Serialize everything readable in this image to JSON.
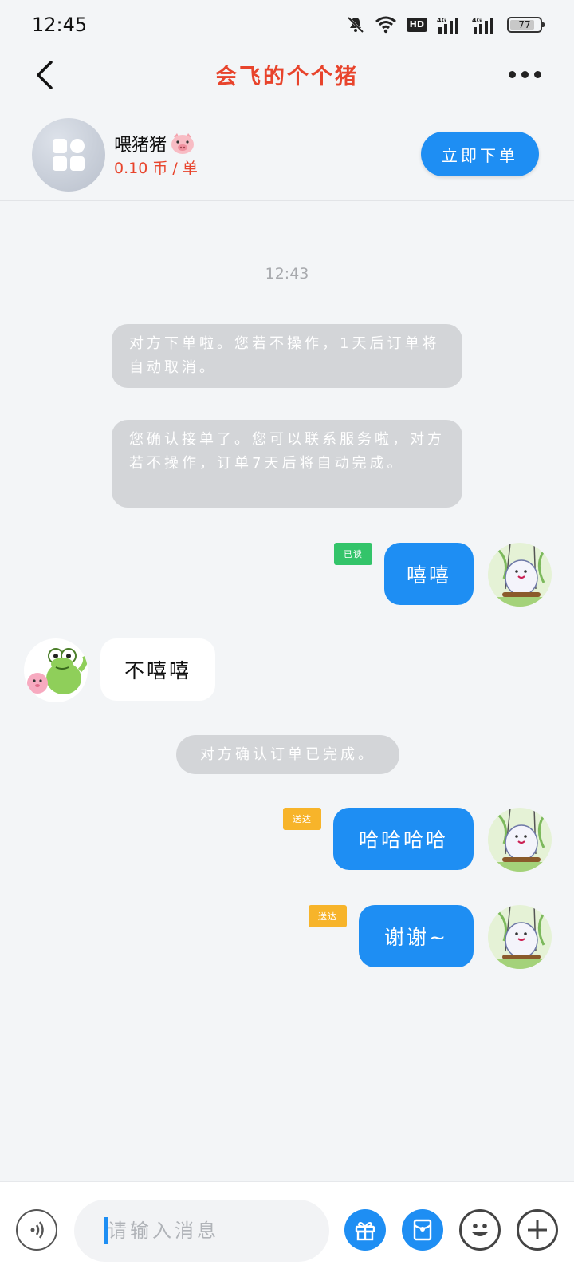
{
  "status_bar": {
    "time": "12:45",
    "icons": [
      "mute-bell-icon",
      "wifi-icon",
      "hd-icon",
      "signal-4g-icon",
      "signal-4g-icon",
      "battery-icon"
    ],
    "hd_label": "HD",
    "network_label": "4G",
    "battery": "77"
  },
  "nav": {
    "title": "会飞的个个猪",
    "back_icon": "chevron-left-icon",
    "more_icon": "more-dots-icon"
  },
  "service": {
    "name": "喂猪猪",
    "name_emoji": "pig-face-icon",
    "price": "0.10 币 / 单",
    "order_button": "立即下单"
  },
  "chat": {
    "timestamp": "12:43",
    "system_messages": [
      "对方下单啦。您若不操作，1天后订单将自动取消。",
      "您确认接单了。您可以联系服务啦，对方若不操作，订单7天后将自动完成。",
      "对方确认订单已完成。"
    ],
    "messages": [
      {
        "direction": "out",
        "text": "嘻嘻",
        "status": "已读"
      },
      {
        "direction": "in",
        "text": "不嘻嘻"
      },
      {
        "direction": "out",
        "text": "哈哈哈哈",
        "status": "送达"
      },
      {
        "direction": "out",
        "text": "谢谢~",
        "status": "送达"
      }
    ]
  },
  "input_bar": {
    "placeholder": "请输入消息",
    "voice_icon": "voice-icon",
    "gift_icon": "gift-icon",
    "red_packet_icon": "red-packet-icon",
    "emoji_icon": "emoji-icon",
    "plus_icon": "plus-icon"
  },
  "colors": {
    "accent": "#1e8ef3",
    "title_red": "#e8442c",
    "read_badge": "#33c46a",
    "sent_badge": "#f7b42a",
    "system_bubble": "#d3d5d8",
    "background": "#f3f5f7"
  }
}
